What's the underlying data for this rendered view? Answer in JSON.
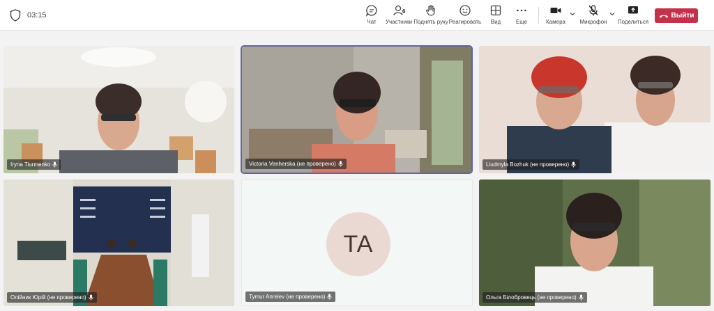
{
  "toolbar": {
    "timer": "03:15",
    "chat_label": "Чат",
    "participants_label": "Участники",
    "participants_count": "6",
    "raise_hand_label": "Поднять руку",
    "react_label": "Реагировать",
    "view_label": "Вид",
    "more_label": "Еще",
    "camera_label": "Камера",
    "mic_label": "Микрофон",
    "share_label": "Поделиться",
    "leave_label": "Выйти"
  },
  "participants": [
    {
      "name": "Iryna Tiurmenko"
    },
    {
      "name": "Victoria Venherska (не проверено)"
    },
    {
      "name": "Liudmyla Bozhuk (не проверено)"
    },
    {
      "name": "Олійник Юрій (не проверено)"
    },
    {
      "name": "Tymur Anreiev (не проверено)",
      "initials": "TA"
    },
    {
      "name": "Ольга Білобровець (не проверено)"
    }
  ],
  "colors": {
    "leave_button": "#c4314b",
    "active_speaker": "#6264a7",
    "avatar_bg": "#ead9d3"
  }
}
